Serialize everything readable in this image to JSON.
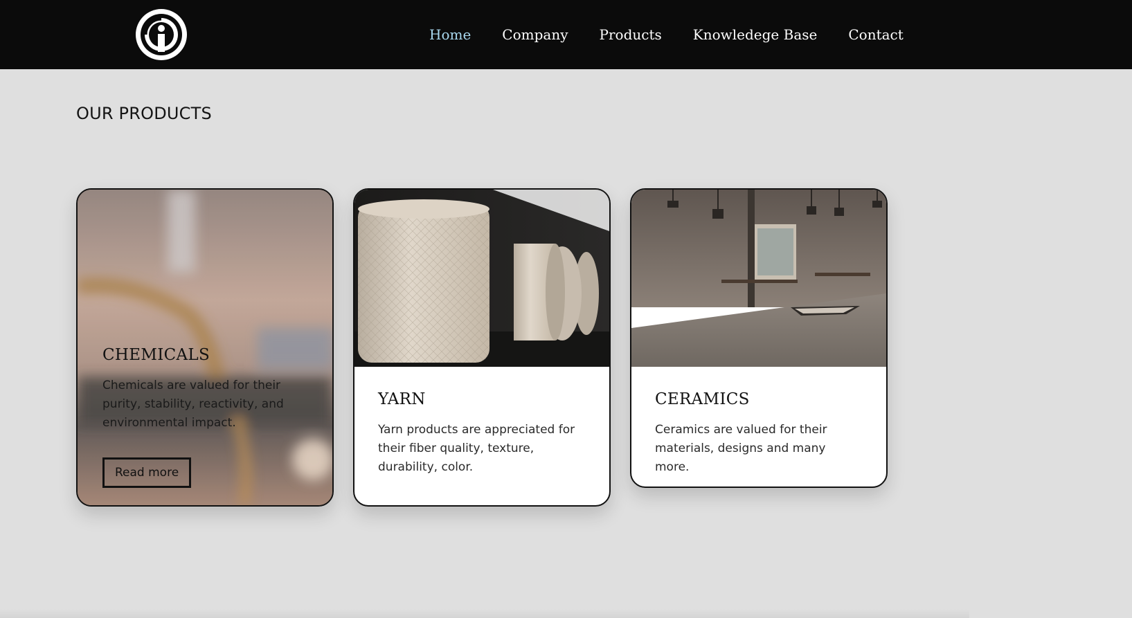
{
  "nav": {
    "items": [
      {
        "label": "Home",
        "active": true
      },
      {
        "label": "Company",
        "active": false
      },
      {
        "label": "Products",
        "active": false
      },
      {
        "label": "Knowledege Base",
        "active": false
      },
      {
        "label": "Contact",
        "active": false
      }
    ],
    "active_color": "#a9d8ef"
  },
  "section": {
    "title": "OUR PRODUCTS"
  },
  "products": [
    {
      "title": "CHEMICALS",
      "description": "Chemicals are valued for their purity, stability, reactivity, and environmental impact.",
      "button_label": "Read more"
    },
    {
      "title": "YARN",
      "description": "Yarn products are appreciated for their fiber quality, texture, durability, color."
    },
    {
      "title": "CERAMICS",
      "description": "Ceramics are valued for their materials, designs and many more."
    }
  ],
  "colors": {
    "header_bg": "#0b0b0b",
    "page_bg": "#dfdfdf",
    "card_border": "#111111"
  }
}
